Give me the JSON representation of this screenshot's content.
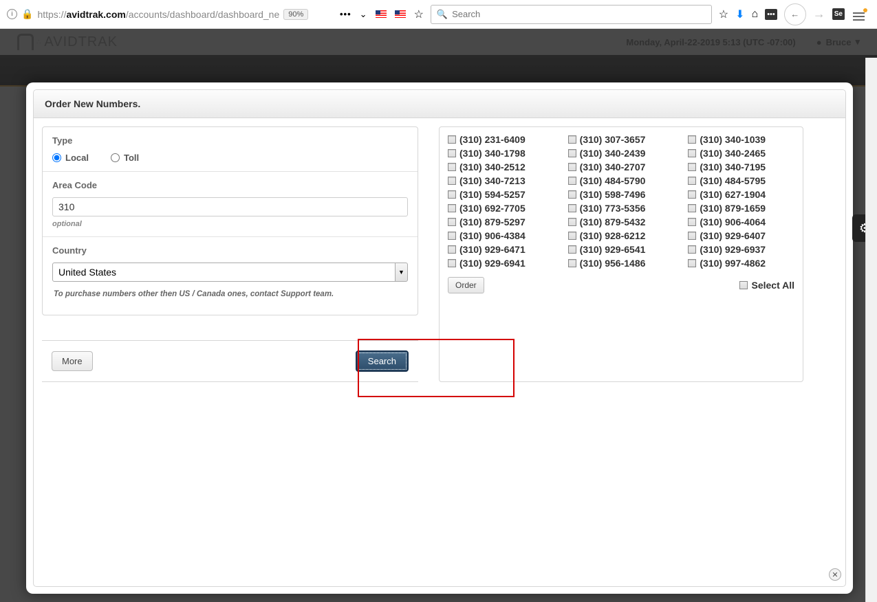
{
  "browser": {
    "url_prefix": "https://",
    "url_host": "avidtrak.com",
    "url_path": "/accounts/dashboard/dashboard_ne",
    "zoom": "90%",
    "search_placeholder": "Search"
  },
  "header": {
    "logo_text": "AVIDTRAK",
    "date": "Monday, April-22-2019 5:13 (UTC -07:00)",
    "user": "Bruce"
  },
  "modal": {
    "title": "Order New Numbers.",
    "type_label": "Type",
    "type_local": "Local",
    "type_toll": "Toll",
    "area_code_label": "Area Code",
    "area_code_value": "310",
    "area_code_hint": "optional",
    "country_label": "Country",
    "country_value": "United States",
    "purchase_note": "To purchase numbers other then US / Canada ones, contact Support team.",
    "more_btn": "More",
    "search_btn": "Search",
    "order_btn": "Order",
    "select_all": "Select All",
    "numbers": [
      "(310) 231-6409",
      "(310) 307-3657",
      "(310) 340-1039",
      "(310) 340-1798",
      "(310) 340-2439",
      "(310) 340-2465",
      "(310) 340-2512",
      "(310) 340-2707",
      "(310) 340-7195",
      "(310) 340-7213",
      "(310) 484-5790",
      "(310) 484-5795",
      "(310) 594-5257",
      "(310) 598-7496",
      "(310) 627-1904",
      "(310) 692-7705",
      "(310) 773-5356",
      "(310) 879-1659",
      "(310) 879-5297",
      "(310) 879-5432",
      "(310) 906-4064",
      "(310) 906-4384",
      "(310) 928-6212",
      "(310) 929-6407",
      "(310) 929-6471",
      "(310) 929-6541",
      "(310) 929-6937",
      "(310) 929-6941",
      "(310) 956-1486",
      "(310) 997-4862"
    ]
  }
}
